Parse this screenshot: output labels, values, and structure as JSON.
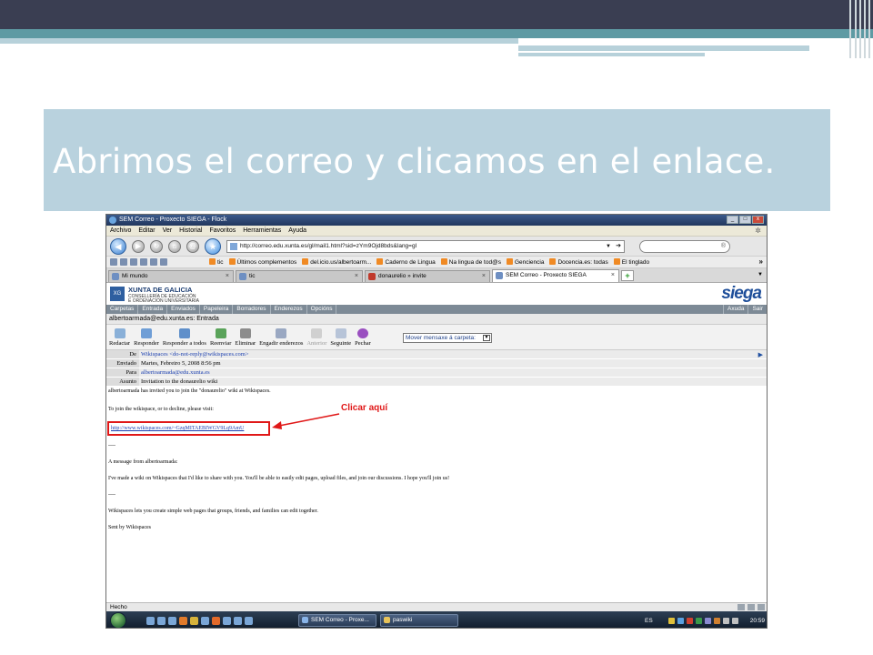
{
  "slide": {
    "title": "Abrimos el correo y clicamos en el enlace."
  },
  "window": {
    "title": "SEM Correo - Proxecto SIEGA - Flock",
    "buttons": [
      "_",
      "□",
      "x"
    ]
  },
  "menu": [
    "Archivo",
    "Editar",
    "Ver",
    "Historial",
    "Favoritos",
    "Herramientas",
    "Ayuda"
  ],
  "address": {
    "url": "http://correo.edu.xunta.es/gl/mail1.html?sid=zYm9Ojd8bds&lang=gl",
    "search_placeholder": "®"
  },
  "bookmarks": [
    "tic",
    "Últimos complementos",
    "del.icio.us/albertoarm...",
    "Caderno de Lingua",
    "Na lingua de tod@s",
    "Genciencia",
    "Docencia.es: todas",
    "El tinglado"
  ],
  "tabs": [
    {
      "label": "Mi mundo",
      "close": "×"
    },
    {
      "label": "tic",
      "close": "×"
    },
    {
      "label": "donaurelio » invite",
      "close": "×"
    },
    {
      "label": "SEM Correo - Proxecto SIEGA",
      "close": "×"
    }
  ],
  "xunta": {
    "title": "XUNTA DE GALICIA",
    "sub1": "CONSELLERÍA DE EDUCACIÓN",
    "sub2": "E ORDENACIÓN UNIVERSITARIA",
    "logo_text": "XG",
    "siega": "siega"
  },
  "mailnav": {
    "items": [
      "Carpetas",
      "Entrada",
      "Enviados",
      "Papeleira",
      "Borradores",
      "Enderezos",
      "Opcións"
    ],
    "right": [
      "Axuda",
      "Sair"
    ]
  },
  "folder_path": "albertoarmada@edu.xunta.es: Entrada",
  "toolbar": {
    "buttons": [
      "Redactar",
      "Responder",
      "Responder a todos",
      "Reenviar",
      "Eliminar",
      "Engadir enderezos",
      "Anterior",
      "Seguinte",
      "Pechar"
    ],
    "move_label": "Mover mensaxe á carpeta:"
  },
  "message": {
    "headers": [
      {
        "label": "De",
        "value": "Wikispaces <do-not-reply@wikispaces.com>"
      },
      {
        "label": "Enviado",
        "value": "Martes, Febreiro 5, 2008 8:56 pm"
      },
      {
        "label": "Para",
        "value": "albertoarmada@edu.xunta.es"
      },
      {
        "label": "Asunto",
        "value": "Invitation to the donaurelio wiki"
      }
    ],
    "body": [
      "albertoarmada has invited you to join the \"donaurelio\" wiki at Wikispaces.",
      "To join the wikispace, or to decline, please visit:",
      "----",
      "A message from albertoarmada:",
      "I've made a wiki on Wikispaces that I'd like to share with you.  You'll be able to easily edit pages, upload files, and join our discussions.  I hope you'll join us!",
      "----",
      "Wikispaces lets you create simple web pages that groups, friends, and families can edit together.",
      "Sent by Wikispaces"
    ],
    "link": "http://www.wikispaces.com/~GzqMITAEBIWGV9Lq9AmU",
    "annotation": "Clicar aquí"
  },
  "status": {
    "text": "Hecho"
  },
  "taskbar": {
    "items": [
      "SEM Correo - Proxe...",
      "paswiki"
    ],
    "lang": "ES",
    "time": "20:59"
  },
  "colors": {
    "slide_title_bg": "#b9d2de",
    "annotation_red": "#e01818",
    "link_blue": "#1a3fb0",
    "mailnav_bg": "#7d8a96"
  }
}
